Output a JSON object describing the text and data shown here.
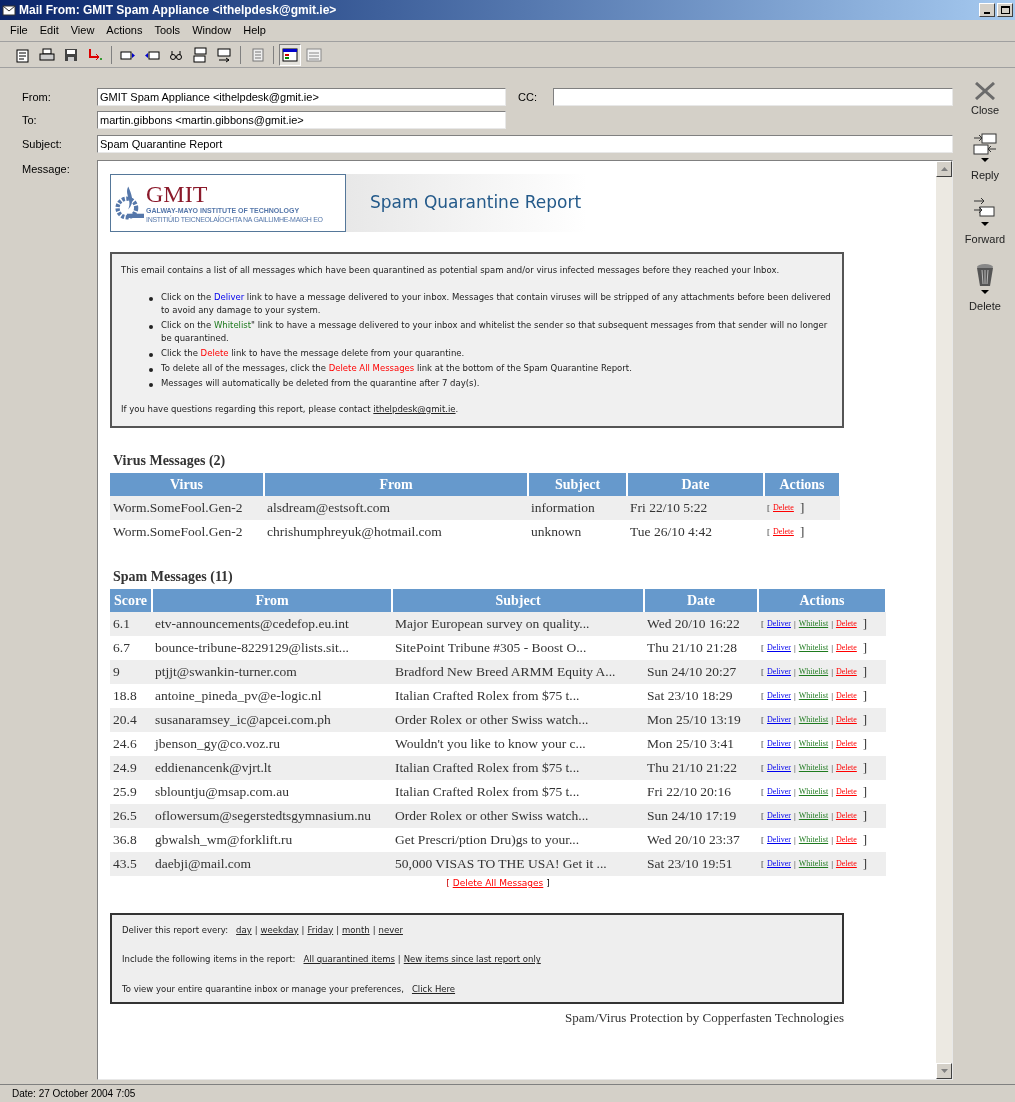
{
  "window": {
    "title": "Mail From: GMIT Spam Appliance <ithelpdesk@gmit.ie>"
  },
  "menu": [
    "File",
    "Edit",
    "View",
    "Actions",
    "Tools",
    "Window",
    "Help"
  ],
  "view_toggles": [
    {
      "selected": true
    },
    {
      "selected": false
    }
  ],
  "header": {
    "from_label": "From:",
    "from": "GMIT Spam Appliance <ithelpdesk@gmit.ie>",
    "cc_label": "CC:",
    "to_label": "To:",
    "to": "martin.gibbons <martin.gibbons@gmit.ie>",
    "subject_label": "Subject:",
    "subject": "Spam Quarantine Report",
    "message_label": "Message:"
  },
  "side_actions": [
    {
      "kind": "close",
      "label": "Close"
    },
    {
      "kind": "reply",
      "label": "Reply"
    },
    {
      "kind": "forward",
      "label": "Forward"
    },
    {
      "kind": "delete",
      "label": "Delete"
    }
  ],
  "banner": {
    "logo": "GMIT",
    "logo_line_1": "GALWAY-MAYO INSTITUTE OF TECHNOLOGY",
    "logo_line_2": "INSTITIÚID TEICNEOLAÍOCHTA NA GAILLIMHE-MAIGH EO",
    "title": "Spam Quarantine Report"
  },
  "intro": {
    "text": "This email contains a list of all messages which have been quarantined as potential spam and/or virus infected messages before they reached your Inbox.",
    "bullets": [
      {
        "before": "Click on the ",
        "link": "Deliver",
        "kind": "deliver",
        "after": " link to have a message delivered to your inbox. Messages that contain viruses will be stripped of any attachments before been delivered to avoid any damage to your system."
      },
      {
        "before": "Click on the ",
        "link": "Whitelist",
        "kind": "whitelist",
        "after": "\" link to have a message delivered to your inbox and whitelist the sender so that subsequent messages from that sender will no longer be quarantined."
      },
      {
        "before": "Click the ",
        "link": "Delete",
        "kind": "delete",
        "after": " link to have the message delete from your quarantine."
      },
      {
        "before": "To delete all of the messages, click the ",
        "link": "Delete All Messages",
        "kind": "delete",
        "after": " link at the bottom of the Spam Quarantine Report."
      },
      {
        "before": "Messages will automatically be deleted from the quarantine after 7 day(s)."
      }
    ],
    "contact_text": "If you have questions regarding this report, please contact ",
    "contact_link": "ithelpdesk@gmit.ie",
    "contact_end": "."
  },
  "virus": {
    "title": "Virus Messages (2)",
    "columns": [
      "Virus",
      "From",
      "Subject",
      "Date",
      "Actions"
    ],
    "rows": [
      {
        "cells": [
          "Worm.SomeFool.Gen-2",
          "alsdream@estsoft.com",
          "information",
          "Fri 22/10 5:22"
        ],
        "open": "[",
        "actions": [
          {
            "kind": "delete",
            "label": "Delete"
          }
        ],
        "close": "]"
      },
      {
        "cells": [
          "Worm.SomeFool.Gen-2",
          "chrishumphreyuk@hotmail.com",
          "unknown",
          "Tue 26/10 4:42"
        ],
        "open": "[",
        "actions": [
          {
            "kind": "delete",
            "label": "Delete"
          }
        ],
        "close": "]"
      }
    ]
  },
  "spam": {
    "title": "Spam Messages (11)",
    "columns": [
      "Score",
      "From",
      "Subject",
      "Date",
      "Actions"
    ],
    "rows": [
      {
        "cells": [
          "6.1",
          "etv-announcements@cedefop.eu.int",
          "Major European survey on quality...",
          "Wed 20/10 16:22"
        ],
        "open": "[",
        "actions": [
          {
            "kind": "deliver",
            "label": "Deliver"
          },
          {
            "kind": "whitelist",
            "label": "Whitelist"
          },
          {
            "kind": "delete",
            "label": "Delete"
          }
        ],
        "separators": [
          "|",
          "|"
        ],
        "close": "]"
      },
      {
        "cells": [
          "6.7",
          "bounce-tribune-8229129@lists.sit...",
          "SitePoint Tribune #305 - Boost O...",
          "Thu 21/10 21:28"
        ],
        "open": "[",
        "actions": [
          {
            "kind": "deliver",
            "label": "Deliver"
          },
          {
            "kind": "whitelist",
            "label": "Whitelist"
          },
          {
            "kind": "delete",
            "label": "Delete"
          }
        ],
        "separators": [
          "|",
          "|"
        ],
        "close": "]"
      },
      {
        "cells": [
          "9",
          "ptjjt@swankin-turner.com",
          "Bradford New Breed ARMM Equity A...",
          "Sun 24/10 20:27"
        ],
        "open": "[",
        "actions": [
          {
            "kind": "deliver",
            "label": "Deliver"
          },
          {
            "kind": "whitelist",
            "label": "Whitelist"
          },
          {
            "kind": "delete",
            "label": "Delete"
          }
        ],
        "separators": [
          "|",
          "|"
        ],
        "close": "]"
      },
      {
        "cells": [
          "18.8",
          "antoine_pineda_pv@e-logic.nl",
          "Italian Crafted Rolex from $75 t...",
          "Sat 23/10 18:29"
        ],
        "open": "[",
        "actions": [
          {
            "kind": "deliver",
            "label": "Deliver"
          },
          {
            "kind": "whitelist",
            "label": "Whitelist"
          },
          {
            "kind": "delete",
            "label": "Delete"
          }
        ],
        "separators": [
          "|",
          "|"
        ],
        "close": "]"
      },
      {
        "cells": [
          "20.4",
          "susanaramsey_ic@apcei.com.ph",
          "Order Rolex or other Swiss watch...",
          "Mon 25/10 13:19"
        ],
        "open": "[",
        "actions": [
          {
            "kind": "deliver",
            "label": "Deliver"
          },
          {
            "kind": "whitelist",
            "label": "Whitelist"
          },
          {
            "kind": "delete",
            "label": "Delete"
          }
        ],
        "separators": [
          "|",
          "|"
        ],
        "close": "]"
      },
      {
        "cells": [
          "24.6",
          "jbenson_gy@co.voz.ru",
          "Wouldn't you like to know your c...",
          "Mon 25/10 3:41"
        ],
        "open": "[",
        "actions": [
          {
            "kind": "deliver",
            "label": "Deliver"
          },
          {
            "kind": "whitelist",
            "label": "Whitelist"
          },
          {
            "kind": "delete",
            "label": "Delete"
          }
        ],
        "separators": [
          "|",
          "|"
        ],
        "close": "]"
      },
      {
        "cells": [
          "24.9",
          "eddienancenk@vjrt.lt",
          "Italian Crafted Rolex from $75 t...",
          "Thu 21/10 21:22"
        ],
        "open": "[",
        "actions": [
          {
            "kind": "deliver",
            "label": "Deliver"
          },
          {
            "kind": "whitelist",
            "label": "Whitelist"
          },
          {
            "kind": "delete",
            "label": "Delete"
          }
        ],
        "separators": [
          "|",
          "|"
        ],
        "close": "]"
      },
      {
        "cells": [
          "25.9",
          "sblountju@msap.com.au",
          "Italian Crafted Rolex from $75 t...",
          "Fri 22/10 20:16"
        ],
        "open": "[",
        "actions": [
          {
            "kind": "deliver",
            "label": "Deliver"
          },
          {
            "kind": "whitelist",
            "label": "Whitelist"
          },
          {
            "kind": "delete",
            "label": "Delete"
          }
        ],
        "separators": [
          "|",
          "|"
        ],
        "close": "]"
      },
      {
        "cells": [
          "26.5",
          "oflowersum@segerstedtsgymnasium.nu",
          "Order Rolex or other Swiss watch...",
          "Sun 24/10 17:19"
        ],
        "open": "[",
        "actions": [
          {
            "kind": "deliver",
            "label": "Deliver"
          },
          {
            "kind": "whitelist",
            "label": "Whitelist"
          },
          {
            "kind": "delete",
            "label": "Delete"
          }
        ],
        "separators": [
          "|",
          "|"
        ],
        "close": "]"
      },
      {
        "cells": [
          "36.8",
          "gbwalsh_wm@forklift.ru",
          "Get Prescri/ption Dru)gs to your...",
          "Wed 20/10 23:37"
        ],
        "open": "[",
        "actions": [
          {
            "kind": "deliver",
            "label": "Deliver"
          },
          {
            "kind": "whitelist",
            "label": "Whitelist"
          },
          {
            "kind": "delete",
            "label": "Delete"
          }
        ],
        "separators": [
          "|",
          "|"
        ],
        "close": "]"
      },
      {
        "cells": [
          "43.5",
          "daebji@mail.com",
          "50,000 VISAS TO THE USA! Get it ...",
          "Sat 23/10 19:51"
        ],
        "open": "[",
        "actions": [
          {
            "kind": "deliver",
            "label": "Deliver"
          },
          {
            "kind": "whitelist",
            "label": "Whitelist"
          },
          {
            "kind": "delete",
            "label": "Delete"
          }
        ],
        "separators": [
          "|",
          "|"
        ],
        "close": "]"
      }
    ],
    "delete_all": {
      "open": "[",
      "label": "Delete All Messages",
      "close": "]"
    }
  },
  "footer": {
    "lines": [
      {
        "text": "Deliver this report every:",
        "links": [
          "day",
          "weekday",
          "Friday",
          "month",
          "never"
        ],
        "separator": "|"
      },
      {
        "text": "Include the following items in the report:",
        "links": [
          "All quarantined items",
          "New items since last report only"
        ],
        "separator": "|"
      },
      {
        "text": "To view your entire quarantine inbox or manage your preferences,",
        "links": [
          "Click Here"
        ]
      }
    ],
    "credit": "Spam/Virus Protection by Copperfasten Technologies"
  },
  "status_bar": "Date: 27 October 2004 7:05"
}
